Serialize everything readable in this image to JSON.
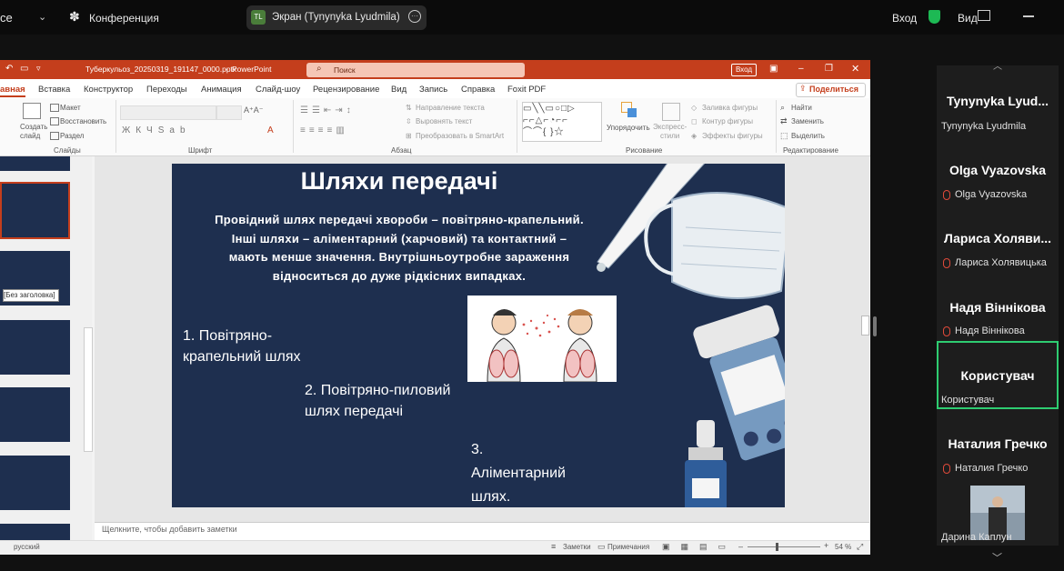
{
  "topbar": {
    "app_fragment": "ce",
    "conference_label": "Конференция",
    "share_initials": "TL",
    "share_label": "Экран (Tynynyka Lyudmila)",
    "login_label": "Вход",
    "view_label": "Вид"
  },
  "ppt": {
    "filename": "Туберкульоз_20250319_191147_0000.pptx",
    "app": "PowerPoint",
    "search_placeholder": "Поиск",
    "signin": "Вход",
    "tabs": [
      "авная",
      "Вставка",
      "Конструктор",
      "Переходы",
      "Анимация",
      "Слайд-шоу",
      "Рецензирование",
      "Вид",
      "Запись",
      "Справка",
      "Foxit PDF"
    ],
    "share_button": "Поделиться",
    "ribbon": {
      "create_slide": "Создать\nслайд",
      "layout": "Макет",
      "restore": "Восстановить",
      "section": "Раздел",
      "group_slides": "Слайды",
      "group_font": "Шрифт",
      "group_paragraph": "Абзац",
      "group_drawing": "Рисование",
      "group_editing": "Редактирование",
      "text_direction": "Направление текста",
      "align_text": "Выровнять текст",
      "smartart": "Преобразовать в SmartArt",
      "arrange": "Упорядочить",
      "express_styles": "Экспресс-\nстили",
      "shape_fill": "Заливка фигуры",
      "shape_outline": "Контур фигуры",
      "shape_effects": "Эффекты фигуры",
      "find": "Найти",
      "replace": "Заменить",
      "select": "Выделить"
    },
    "thumb_tooltip": "[Без заголовка]",
    "notes_placeholder": "Щелкните, чтобы добавить заметки",
    "status": {
      "language": "русский",
      "notes": "Заметки",
      "comments": "Примечания",
      "zoom": "54 %"
    }
  },
  "slide": {
    "title": "Шляхи передачі",
    "paragraph": [
      "Провідний шлях передачі хвороби – повітряно-крапельний.",
      "Інші шляхи – аліментарний (харчовий) та контактний –",
      "мають менше значення. Внутрішньоутробне зараження",
      "відноситься до дуже рідкісних випадках."
    ],
    "item1": [
      "1. Повітряно-",
      "крапельний шлях"
    ],
    "item2": [
      "2. Повітряно-пиловий",
      "шлях передачі"
    ],
    "item3": [
      "3.",
      "Аліментарний",
      "шлях."
    ]
  },
  "participants": [
    {
      "tile_name": "Tynynyka  Lyud...",
      "sub": "Tynynyka Lyudmila",
      "muted": false
    },
    {
      "tile_name": "Olga Vyazovska",
      "sub": "Olga Vyazovska",
      "muted": true
    },
    {
      "tile_name": "Лариса  Холяви...",
      "sub": "Лариса Холявицька",
      "muted": true
    },
    {
      "tile_name": "Надя Віннікова",
      "sub": "Надя Віннікова",
      "muted": true
    },
    {
      "tile_name": "Користувач",
      "sub": "Користувач",
      "muted": false
    },
    {
      "tile_name": "Наталия Гречко",
      "sub": "Наталия Гречко",
      "muted": true
    },
    {
      "tile_name": "",
      "sub": "Дарина Каплун",
      "muted": false
    }
  ],
  "colors": {
    "ppt_red": "#c43e1c",
    "slide_bg": "#1e2f4f",
    "active_speaker": "#2ecc71",
    "muted": "#e04a3a"
  }
}
